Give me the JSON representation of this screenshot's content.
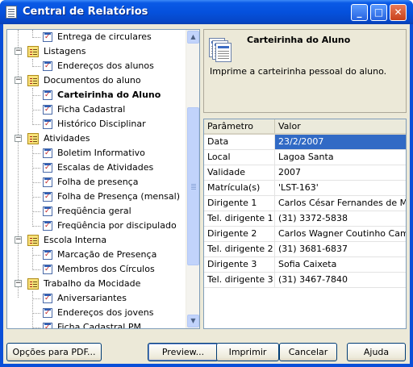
{
  "window": {
    "title": "Central de Relatórios"
  },
  "titlebar_buttons": {
    "minimize": "_",
    "maximize": "□",
    "close": "✕"
  },
  "tree": {
    "rows": [
      {
        "label": "Entrega de circulares",
        "kind": "report"
      },
      {
        "label": "Listagens",
        "kind": "folder",
        "expander": "−"
      },
      {
        "label": "Endereços dos alunos",
        "kind": "report"
      },
      {
        "label": "Documentos do aluno",
        "kind": "folder",
        "expander": "−"
      },
      {
        "label": "Carteirinha do Aluno",
        "kind": "report",
        "selected": true
      },
      {
        "label": "Ficha Cadastral",
        "kind": "report"
      },
      {
        "label": "Histórico Disciplinar",
        "kind": "report"
      },
      {
        "label": "Atividades",
        "kind": "folder",
        "expander": "−"
      },
      {
        "label": "Boletim Informativo",
        "kind": "report"
      },
      {
        "label": "Escalas de Atividades",
        "kind": "report"
      },
      {
        "label": "Folha de presença",
        "kind": "report"
      },
      {
        "label": "Folha de Presença (mensal)",
        "kind": "report"
      },
      {
        "label": "Freqüência geral",
        "kind": "report"
      },
      {
        "label": "Freqüência por discipulado",
        "kind": "report"
      },
      {
        "label": "Escola Interna",
        "kind": "folder",
        "expander": "−"
      },
      {
        "label": "Marcação de Presença",
        "kind": "report"
      },
      {
        "label": "Membros dos Círculos",
        "kind": "report"
      },
      {
        "label": "Trabalho da Mocidade",
        "kind": "folder",
        "expander": "−"
      },
      {
        "label": "Aniversariantes",
        "kind": "report"
      },
      {
        "label": "Endereços dos jovens",
        "kind": "report"
      },
      {
        "label": "Ficha Cadastral PM",
        "kind": "report"
      }
    ],
    "scroll_up": "▲",
    "scroll_down": "▼"
  },
  "info": {
    "title": "Carteirinha do Aluno",
    "description": "Imprime a carteirinha pessoal do aluno."
  },
  "params": {
    "headers": [
      "Parâmetro",
      "Valor"
    ],
    "rows": [
      {
        "name": "Data",
        "value": "23/2/2007",
        "selected": true
      },
      {
        "name": "Local",
        "value": "Lagoa Santa"
      },
      {
        "name": "Validade",
        "value": "2007"
      },
      {
        "name": "Matrícula(s)",
        "value": "'LST-163'"
      },
      {
        "name": "Dirigente 1",
        "value": "Carlos César Fernandes de Mora"
      },
      {
        "name": "Tel. dirigente 1",
        "value": "(31) 3372-5838"
      },
      {
        "name": "Dirigente 2",
        "value": "Carlos Wagner Coutinho Campos"
      },
      {
        "name": "Tel. dirigente 2",
        "value": "(31) 3681-6837"
      },
      {
        "name": "Dirigente 3",
        "value": "Sofia Caixeta"
      },
      {
        "name": "Tel. dirigente 3",
        "value": "(31) 3467-7840"
      }
    ]
  },
  "buttons": {
    "pdf_options": "Opções para PDF...",
    "preview": "Preview...",
    "print": "Imprimir",
    "cancel": "Cancelar",
    "help": "Ajuda"
  },
  "colors": {
    "title_bar": "#0551dd",
    "selection": "#316ac5",
    "dialog_bg": "#ece9d8"
  }
}
